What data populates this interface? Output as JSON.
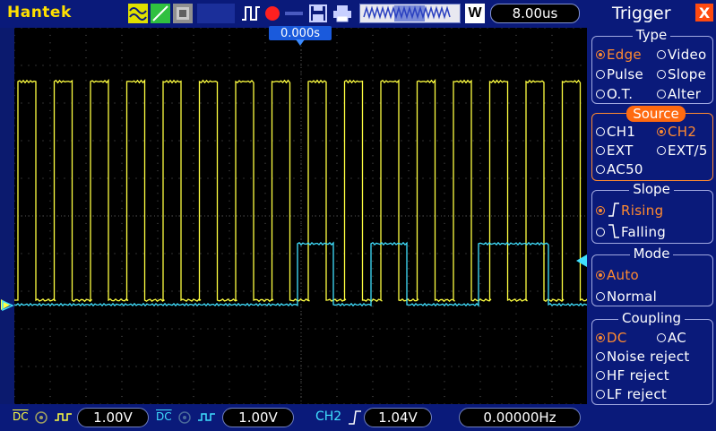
{
  "brand": "Hantek",
  "toolbar": {
    "wave_button": "W",
    "timebase": "8.00us"
  },
  "trigger_offset": "0.000s",
  "bottom": {
    "ch1_coupling": "DC",
    "ch1_volts": "1.00V",
    "ch2_coupling": "DC",
    "ch2_volts": "1.00V",
    "trig_channel": "CH2",
    "trig_level": "1.04V",
    "frequency": "0.00000Hz"
  },
  "panel": {
    "title": "Trigger",
    "close": "X",
    "type_label": "Type",
    "type_opts": [
      "Edge",
      "Video",
      "Pulse",
      "Slope",
      "O.T.",
      "Alter"
    ],
    "source_label": "Source",
    "source_opts": [
      "CH1",
      "CH2",
      "EXT",
      "EXT/5",
      "AC50"
    ],
    "slope_label": "Slope",
    "slope_opts": [
      "Rising",
      "Falling"
    ],
    "mode_label": "Mode",
    "mode_opts": [
      "Auto",
      "Normal"
    ],
    "coupling_label": "Coupling",
    "coupling_opts": [
      "DC",
      "AC",
      "Noise reject",
      "HF reject",
      "LF reject"
    ]
  },
  "colors": {
    "ch1": "#ffff40",
    "ch2": "#40e0ff",
    "accent": "#ff8a30"
  }
}
